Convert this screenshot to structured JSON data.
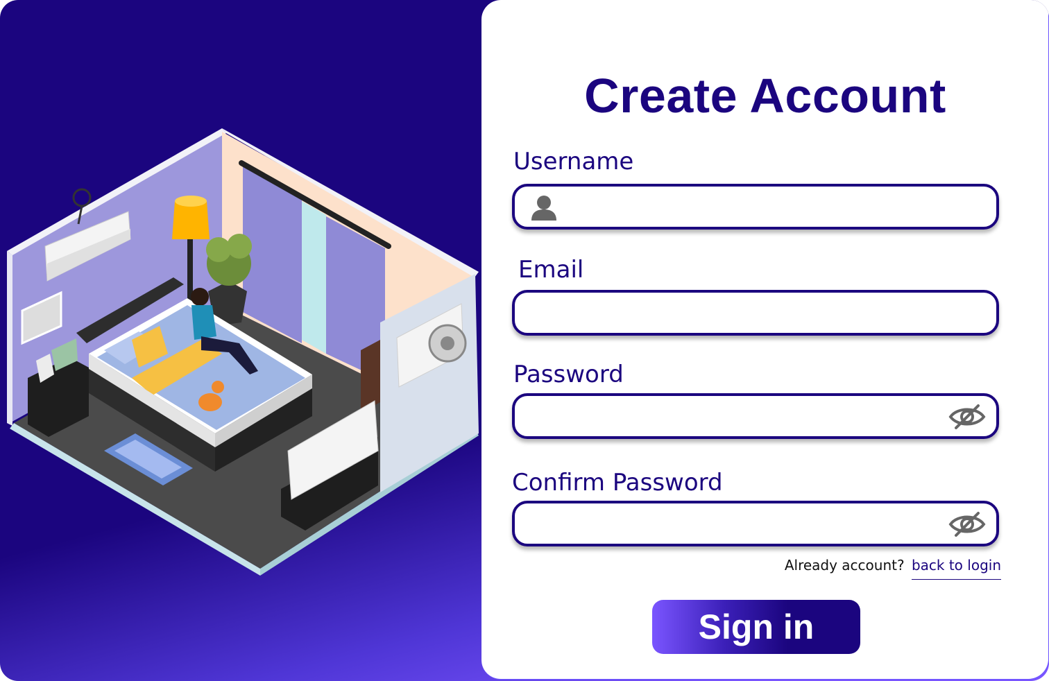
{
  "form": {
    "title": "Create Account",
    "username": {
      "label": "Username",
      "value": "",
      "placeholder": ""
    },
    "email": {
      "label": "Email",
      "value": "",
      "placeholder": ""
    },
    "password": {
      "label": "Password",
      "value": "",
      "placeholder": ""
    },
    "confirm_password": {
      "label": "Confirm Password",
      "value": "",
      "placeholder": ""
    },
    "already_text": "Already account?",
    "login_link": "back to login",
    "submit_label": "Sign in"
  },
  "icons": {
    "username": "user-icon",
    "password_toggle": "eye-slash-icon",
    "confirm_toggle": "eye-slash-icon"
  },
  "colors": {
    "primary": "#1b057f",
    "accent": "#7a55ff",
    "icon_gray": "#666666"
  }
}
